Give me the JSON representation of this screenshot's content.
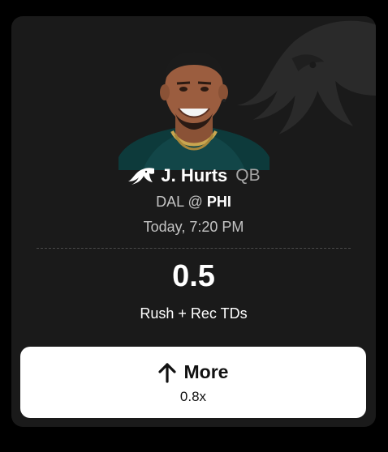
{
  "player": {
    "name": "J. Hurts",
    "position": "QB",
    "team_logo_icon": "eagles-logo-icon",
    "photo": "player-headshot"
  },
  "game": {
    "away": "DAL",
    "separator": "@",
    "home": "PHI",
    "time": "Today, 7:20 PM"
  },
  "projection": {
    "line": "0.5",
    "stat": "Rush + Rec TDs"
  },
  "pick": {
    "icon": "arrow-up-icon",
    "label": "More",
    "multiplier": "0.8x"
  },
  "colors": {
    "background": "#000000",
    "card": "#1a1a1a",
    "jersey": "#0b3b3c",
    "button": "#ffffff",
    "muted_text": "#c4c4c4"
  }
}
